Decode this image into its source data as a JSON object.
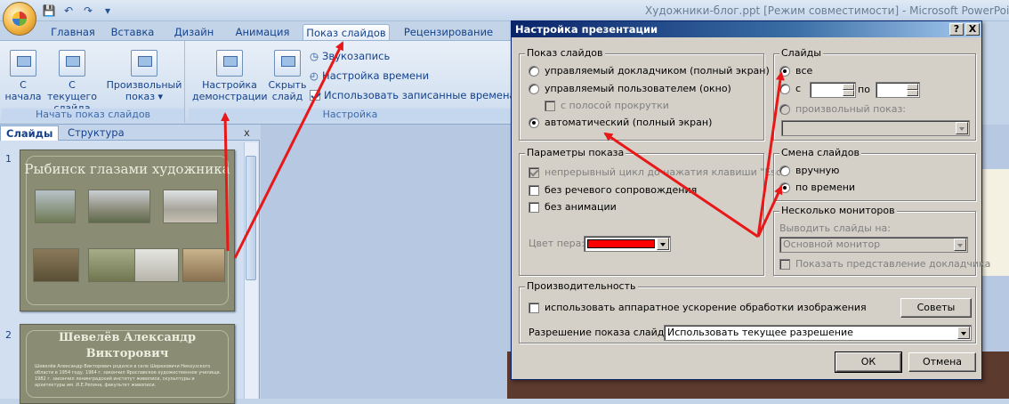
{
  "window": {
    "title": "Художники-блог.ppt [Режим совместимости] - Microsoft PowerPoint"
  },
  "tabs": [
    {
      "label": "Главная"
    },
    {
      "label": "Вставка"
    },
    {
      "label": "Дизайн"
    },
    {
      "label": "Анимация"
    },
    {
      "label": "Показ слайдов"
    },
    {
      "label": "Рецензирование"
    }
  ],
  "ribbon": {
    "group_start": {
      "label": "Начать показ слайдов",
      "from_start": "С начала",
      "from_current": "С текущего слайда",
      "custom_show": "Произвольный показ"
    },
    "group_setup": {
      "label": "Настройка",
      "setup_show": "Настройка демонстрации",
      "hide_slide": "Скрыть слайд",
      "record_narration": "Звукозапись",
      "rehearse_timings": "Настройка времени",
      "use_timings": "Использовать записанные времена"
    }
  },
  "pane": {
    "tab_slides": "Слайды",
    "tab_outline": "Структура",
    "close": "x",
    "slides": [
      {
        "number": "1",
        "title": "Рыбинск глазами художника"
      },
      {
        "number": "2",
        "title": "Шевелёв Александр Викторович",
        "body": "Шевелёв Александр Викторович родился в селе Шереховичи Некоузского области в 1954 году. 1964 г. закончил Ярославское художественное училище. 1982 г. закончил ленинградский институт живописи, скульптуры и архитектуры им. И.Е.Репина, факультет живописи."
      }
    ]
  },
  "dialog": {
    "title": "Настройка презентации",
    "help": "?",
    "close": "X",
    "show_type": {
      "legend": "Показ слайдов",
      "opt_presenter": "управляемый докладчиком (полный экран)",
      "opt_individual": "управляемый пользователем (окно)",
      "opt_scrollbar": "с полосой прокрутки",
      "opt_kiosk": "автоматический (полный экран)"
    },
    "slides": {
      "legend": "Слайды",
      "opt_all": "все",
      "opt_from": "с",
      "to_label": "по",
      "from_value": "",
      "to_value": "",
      "opt_custom": "произвольный показ:"
    },
    "show_options": {
      "legend": "Параметры показа",
      "loop": "непрерывный цикл до нажатия клавиши \"Esc\"",
      "no_narration": "без речевого сопровождения",
      "no_animation": "без анимации",
      "pen_color_label": "Цвет пера:",
      "pen_color": "#ff0000"
    },
    "advance": {
      "legend": "Смена слайдов",
      "opt_manual": "вручную",
      "opt_timings": "по времени"
    },
    "monitors": {
      "legend": "Несколько мониторов",
      "display_on_label": "Выводить слайды на:",
      "display_on_value": "Основной монитор",
      "presenter_view": "Показать представление докладчика"
    },
    "performance": {
      "legend": "Производительность",
      "hw_accel": "использовать аппаратное ускорение обработки изображения",
      "tips_button": "Советы",
      "resolution_label": "Разрешение показа слайдов:",
      "resolution_value": "Использовать текущее разрешение"
    },
    "ok": "ОК",
    "cancel": "Отмена"
  },
  "colors": {
    "annotation_arrow": "#e81818",
    "slide_bg": "#8a8c73",
    "dialog_title": "#0a246a"
  }
}
